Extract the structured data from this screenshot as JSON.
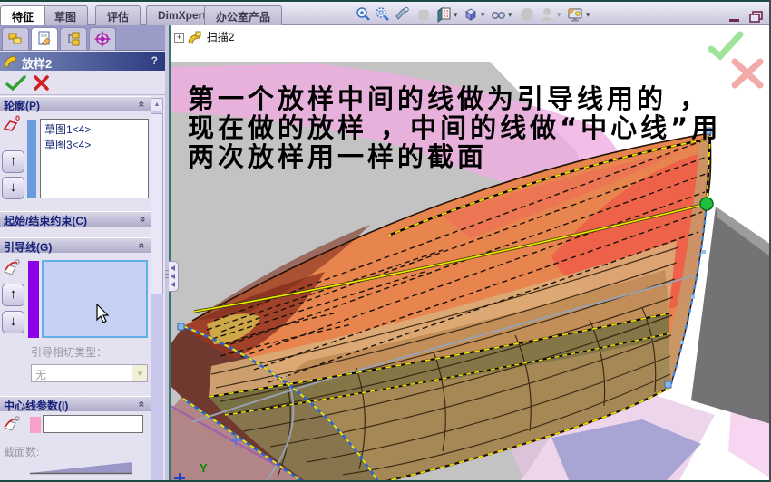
{
  "glyphs": {
    "dropdown_arrow": "▾",
    "chevron_double": "«",
    "arrow_up": "↑",
    "arrow_down": "↓",
    "plus": "+",
    "scroll_up": "▲",
    "help": "?"
  },
  "command_tabs": [
    {
      "label": "特征",
      "active": true
    },
    {
      "label": "草图",
      "active": false
    },
    {
      "label": "评估",
      "active": false
    },
    {
      "label": "DimXpert",
      "active": false
    },
    {
      "label": "办公室产品",
      "active": false
    }
  ],
  "toolbar": {
    "icons": [
      "zoom-in",
      "zoom-to-area",
      "magnifier",
      "rollback",
      "section-view",
      "view-orientation",
      "display-style",
      "shadows",
      "camera",
      "appearance-scene"
    ]
  },
  "property_manager": {
    "title": "放样2",
    "profiles": {
      "header": "轮廓(P)",
      "items": [
        "草图1<4>",
        "草图3<4>"
      ]
    },
    "start_end_constraints": {
      "header": "起始/结束约束(C)"
    },
    "guide_curves": {
      "header": "引导线(G)",
      "tangency_label": "引导相切类型：",
      "tangency_value": "无"
    },
    "centerline": {
      "header": "中心线参数(I)",
      "sections_label": "截面数:"
    }
  },
  "feature_tree": {
    "item": "扫描2"
  },
  "annotation": {
    "line1": "第一个放样中间的线做为引导线用的 ，",
    "line2": "现在做的放样 ，中间的线做“中心线”用",
    "line3": "两次放样用一样的截面"
  },
  "viewport": {
    "axis_y": "Y"
  },
  "colors": {
    "surface_orange": "#E8854E",
    "surface_red": "#F05848",
    "cap_maroon": "#70392F",
    "olive": "#8F8A58",
    "tan": "#D9AD79",
    "plane_gray": "#6B6B6B",
    "pink_wash": "#F0ACE2",
    "background_gray": "#C3C3C3",
    "selection_yellow": "#F0E400",
    "endpoint_green": "#1FBE3C",
    "guide_bar_purple": "#8A00E8",
    "profile_bar_blue": "#6B9BDF",
    "header_navy": "#2A3A7E"
  }
}
